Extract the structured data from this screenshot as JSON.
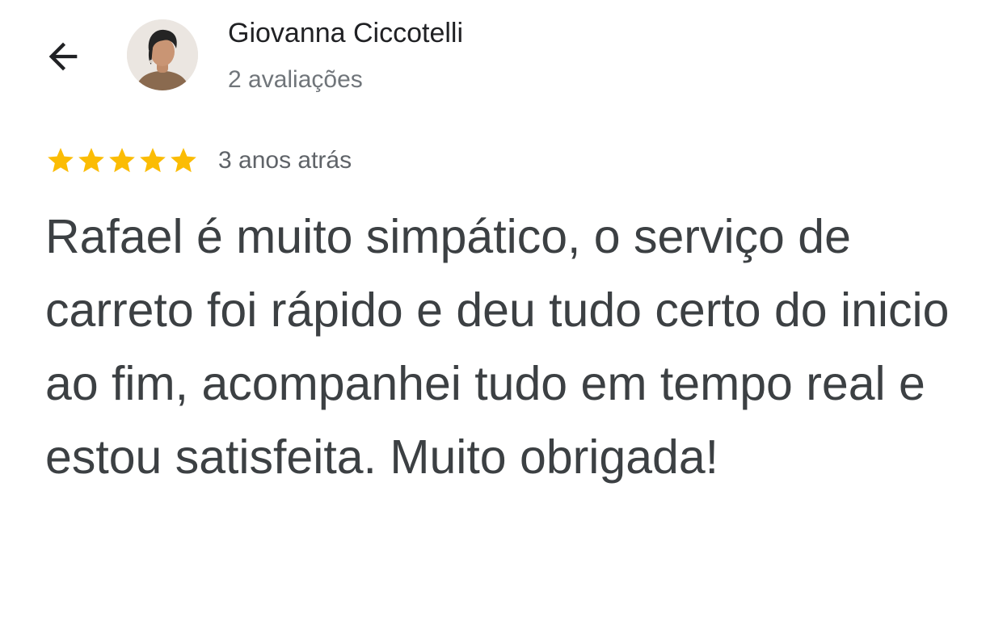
{
  "header": {
    "back_icon": "arrow-left-icon",
    "avatar_icon": "user-avatar",
    "reviewer_name": "Giovanna Ciccotelli",
    "review_count": "2 avaliações"
  },
  "review": {
    "rating": 5,
    "rating_max": 5,
    "star_icon": "star-icon",
    "star_color": "#fbbc04",
    "date": "3 anos atrás",
    "text": "Rafael é muito simpático, o serviço de carreto foi rápido e deu tudo certo do inicio ao fim, acompanhei tudo em tempo real e estou satisfeita. Muito obrigada!"
  },
  "colors": {
    "name": "#202124",
    "secondary": "#70757a",
    "body_text": "#3c4043"
  }
}
